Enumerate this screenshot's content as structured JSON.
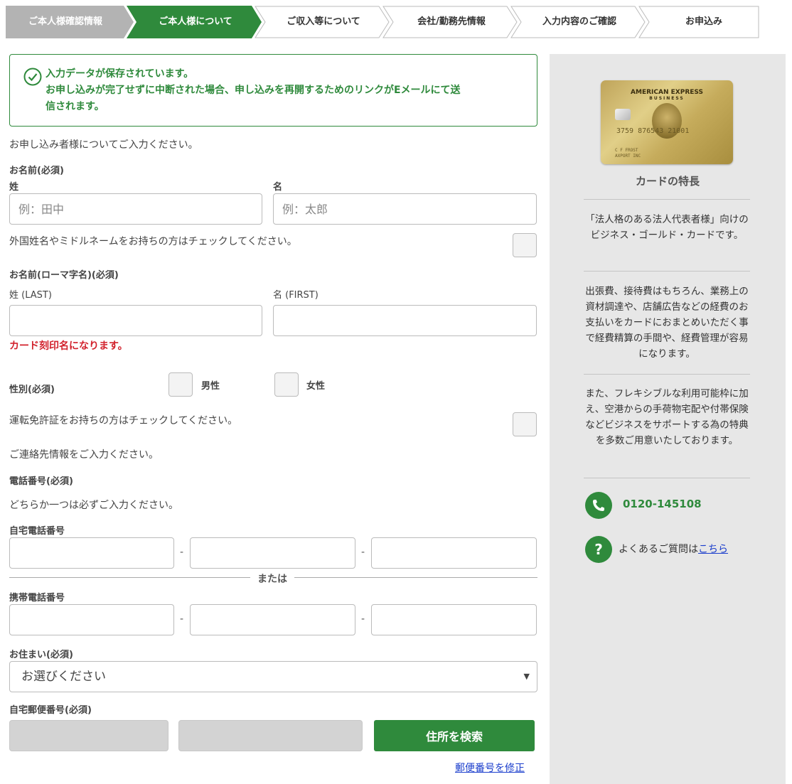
{
  "steps": [
    {
      "label": "ご本人様確認情報",
      "state": "done"
    },
    {
      "label": "ご本人様について",
      "state": "active"
    },
    {
      "label": "ご収入等について",
      "state": "todo"
    },
    {
      "label": "会社/勤務先情報",
      "state": "todo"
    },
    {
      "label": "入力内容のご確認",
      "state": "todo"
    },
    {
      "label": "お申込み",
      "state": "todo"
    }
  ],
  "notice": {
    "line1": "入力データが保存されています。",
    "line2": "お申し込みが完了せずに中断された場合、申し込みを再開するためのリンクがEメールにて送",
    "line3": "信されます。"
  },
  "form": {
    "intro": "お申し込み者様についてご入力ください。",
    "name_label": "お名前(必須)",
    "last_label": "姓",
    "first_label": "名",
    "last_placeholder": "例：田中",
    "first_placeholder": "例：太郎",
    "foreign_name_text": "外国姓名やミドルネームをお持ちの方はチェックしてください。",
    "roman_label": "お名前(ローマ字名)(必須)",
    "roman_last_label": "姓 (LAST)",
    "roman_first_label": "名 (FIRST)",
    "card_note": "カード刻印名になります。",
    "gender_label": "性別(必須)",
    "male": "男性",
    "female": "女性",
    "license_text": "運転免許証をお持ちの方はチェックしてください。",
    "contact_intro": "ご連絡先情報をご入力ください。",
    "phone_label": "電話番号(必須)",
    "phone_note": "どちらか一つは必ずご入力ください。",
    "home_phone_label": "自宅電話番号",
    "or_text": "または",
    "mobile_label": "携帯電話番号",
    "dash": "-",
    "residence_label": "お住まい(必須)",
    "residence_value": "お選びください",
    "postal_label": "自宅郵便番号(必須)",
    "search_button": "住所を検索",
    "fix_postal_link": "郵便番号を修正"
  },
  "sidebar": {
    "card_brand": "AMERICAN EXPRESS",
    "card_sub": "BUSINESS",
    "card_number": "3759 876543 21001",
    "card_holder": "C F FROST",
    "card_company": "AXPORT INC",
    "title": "カードの特長",
    "para1": "「法人格のある法人代表者様」向けのビジネス・ゴールド・カードです。",
    "para2": "出張費、接待費はもちろん、業務上の資材調達や、店舗広告などの経費のお支払いをカードにおまとめいただく事で経費精算の手間や、経費管理が容易になります。",
    "para3": "また、フレキシブルな利用可能枠に加え、空港からの手荷物宅配や付帯保険などビジネスをサポートする為の特典を多数ご用意いたしております。",
    "phone": "0120-145108",
    "faq_prefix": "よくあるご質問は",
    "faq_link": "こちら"
  },
  "colors": {
    "brand_green": "#2f8a3c",
    "step_done": "#b3b3b3",
    "error_red": "#d2222d",
    "link_blue": "#1a3dcc",
    "sidebar_bg": "#e7e7e7"
  }
}
